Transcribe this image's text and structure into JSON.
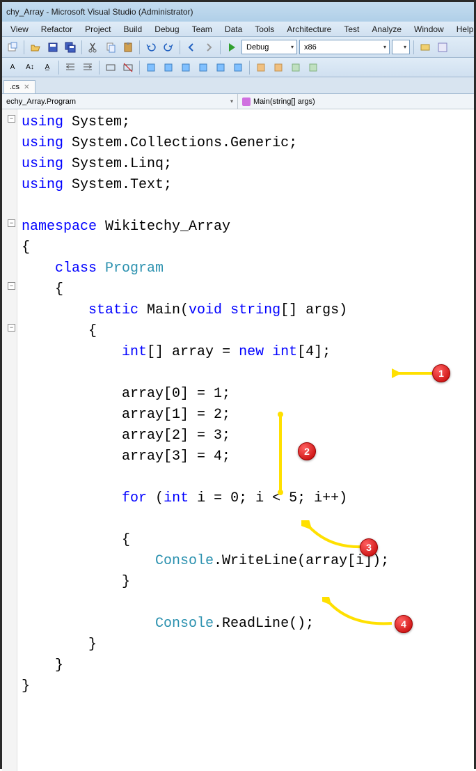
{
  "titlebar": {
    "text": "chy_Array - Microsoft Visual Studio (Administrator)"
  },
  "menu": {
    "items": [
      "View",
      "Refactor",
      "Project",
      "Build",
      "Debug",
      "Team",
      "Data",
      "Tools",
      "Architecture",
      "Test",
      "Analyze",
      "Window",
      "Help"
    ]
  },
  "toolbar": {
    "config_dropdown": "Debug",
    "platform_dropdown": "x86",
    "empty_dropdown": ""
  },
  "tab": {
    "label": ".cs"
  },
  "crumb": {
    "left": "echy_Array.Program",
    "right": "Main(string[] args)"
  },
  "code": {
    "lines": [
      {
        "t": "using ",
        "k": "using",
        "rest": "System;"
      },
      {
        "t": "using ",
        "k": "using",
        "rest": "System.Collections.Generic;"
      },
      {
        "t": "using ",
        "k": "using",
        "rest": "System.Linq;"
      },
      {
        "t": "using ",
        "k": "using",
        "rest": "System.Text;"
      },
      {
        "blank": true
      },
      {
        "t": "namespace ",
        "k": "namespace",
        "rest": "Wikitechy_Array"
      },
      {
        "raw": "{"
      },
      {
        "indent": "    ",
        "k": "class",
        "sp": " ",
        "typ": "Program"
      },
      {
        "raw": "    {"
      },
      {
        "indent": "        ",
        "k": "static",
        "sp": " ",
        "k2": "void",
        "sp2": " ",
        "rest": "Main(",
        "k3": "string",
        "rest2": "[] args)"
      },
      {
        "raw": "        {"
      },
      {
        "indent": "            ",
        "k": "int",
        "rest": "[] array = ",
        "k2": "new",
        "sp2": " ",
        "k3": "int",
        "rest2": "[4];"
      },
      {
        "blank": true
      },
      {
        "raw": "            array[0] = 1;"
      },
      {
        "raw": "            array[1] = 2;"
      },
      {
        "raw": "            array[2] = 3;"
      },
      {
        "raw": "            array[3] = 4;"
      },
      {
        "blank": true
      },
      {
        "indent": "            ",
        "k": "for",
        "rest": " (",
        "k2": "int",
        "rest2": " i = 0; i < 5; i++)"
      },
      {
        "blank": true
      },
      {
        "raw": "            {"
      },
      {
        "indent": "                ",
        "typ": "Console",
        "rest": ".WriteLine(array[i]);"
      },
      {
        "raw": "            }"
      },
      {
        "blank": true
      },
      {
        "indent": "                ",
        "typ": "Console",
        "rest": ".ReadLine();"
      },
      {
        "raw": "        }"
      },
      {
        "raw": "    }"
      },
      {
        "raw": "}"
      }
    ]
  },
  "annotations": {
    "badge1": "1",
    "badge2": "2",
    "badge3": "3",
    "badge4": "4"
  }
}
